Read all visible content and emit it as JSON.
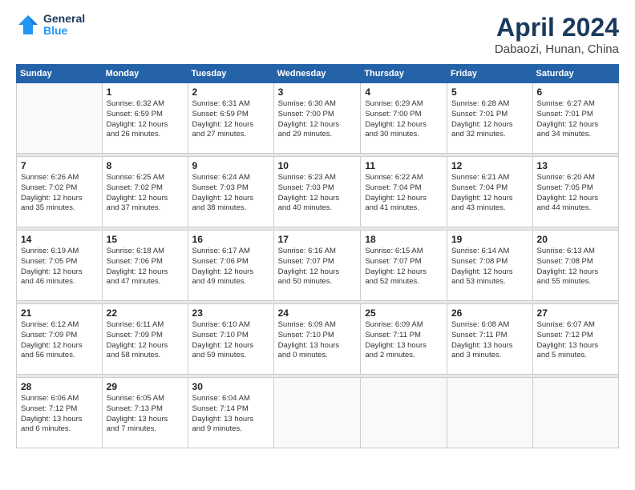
{
  "header": {
    "logo_line1": "General",
    "logo_line2": "Blue",
    "month_title": "April 2024",
    "location": "Dabaozi, Hunan, China"
  },
  "weekdays": [
    "Sunday",
    "Monday",
    "Tuesday",
    "Wednesday",
    "Thursday",
    "Friday",
    "Saturday"
  ],
  "weeks": [
    [
      {
        "day": "",
        "content": ""
      },
      {
        "day": "1",
        "content": "Sunrise: 6:32 AM\nSunset: 6:59 PM\nDaylight: 12 hours\nand 26 minutes."
      },
      {
        "day": "2",
        "content": "Sunrise: 6:31 AM\nSunset: 6:59 PM\nDaylight: 12 hours\nand 27 minutes."
      },
      {
        "day": "3",
        "content": "Sunrise: 6:30 AM\nSunset: 7:00 PM\nDaylight: 12 hours\nand 29 minutes."
      },
      {
        "day": "4",
        "content": "Sunrise: 6:29 AM\nSunset: 7:00 PM\nDaylight: 12 hours\nand 30 minutes."
      },
      {
        "day": "5",
        "content": "Sunrise: 6:28 AM\nSunset: 7:01 PM\nDaylight: 12 hours\nand 32 minutes."
      },
      {
        "day": "6",
        "content": "Sunrise: 6:27 AM\nSunset: 7:01 PM\nDaylight: 12 hours\nand 34 minutes."
      }
    ],
    [
      {
        "day": "7",
        "content": "Sunrise: 6:26 AM\nSunset: 7:02 PM\nDaylight: 12 hours\nand 35 minutes."
      },
      {
        "day": "8",
        "content": "Sunrise: 6:25 AM\nSunset: 7:02 PM\nDaylight: 12 hours\nand 37 minutes."
      },
      {
        "day": "9",
        "content": "Sunrise: 6:24 AM\nSunset: 7:03 PM\nDaylight: 12 hours\nand 38 minutes."
      },
      {
        "day": "10",
        "content": "Sunrise: 6:23 AM\nSunset: 7:03 PM\nDaylight: 12 hours\nand 40 minutes."
      },
      {
        "day": "11",
        "content": "Sunrise: 6:22 AM\nSunset: 7:04 PM\nDaylight: 12 hours\nand 41 minutes."
      },
      {
        "day": "12",
        "content": "Sunrise: 6:21 AM\nSunset: 7:04 PM\nDaylight: 12 hours\nand 43 minutes."
      },
      {
        "day": "13",
        "content": "Sunrise: 6:20 AM\nSunset: 7:05 PM\nDaylight: 12 hours\nand 44 minutes."
      }
    ],
    [
      {
        "day": "14",
        "content": "Sunrise: 6:19 AM\nSunset: 7:05 PM\nDaylight: 12 hours\nand 46 minutes."
      },
      {
        "day": "15",
        "content": "Sunrise: 6:18 AM\nSunset: 7:06 PM\nDaylight: 12 hours\nand 47 minutes."
      },
      {
        "day": "16",
        "content": "Sunrise: 6:17 AM\nSunset: 7:06 PM\nDaylight: 12 hours\nand 49 minutes."
      },
      {
        "day": "17",
        "content": "Sunrise: 6:16 AM\nSunset: 7:07 PM\nDaylight: 12 hours\nand 50 minutes."
      },
      {
        "day": "18",
        "content": "Sunrise: 6:15 AM\nSunset: 7:07 PM\nDaylight: 12 hours\nand 52 minutes."
      },
      {
        "day": "19",
        "content": "Sunrise: 6:14 AM\nSunset: 7:08 PM\nDaylight: 12 hours\nand 53 minutes."
      },
      {
        "day": "20",
        "content": "Sunrise: 6:13 AM\nSunset: 7:08 PM\nDaylight: 12 hours\nand 55 minutes."
      }
    ],
    [
      {
        "day": "21",
        "content": "Sunrise: 6:12 AM\nSunset: 7:09 PM\nDaylight: 12 hours\nand 56 minutes."
      },
      {
        "day": "22",
        "content": "Sunrise: 6:11 AM\nSunset: 7:09 PM\nDaylight: 12 hours\nand 58 minutes."
      },
      {
        "day": "23",
        "content": "Sunrise: 6:10 AM\nSunset: 7:10 PM\nDaylight: 12 hours\nand 59 minutes."
      },
      {
        "day": "24",
        "content": "Sunrise: 6:09 AM\nSunset: 7:10 PM\nDaylight: 13 hours\nand 0 minutes."
      },
      {
        "day": "25",
        "content": "Sunrise: 6:09 AM\nSunset: 7:11 PM\nDaylight: 13 hours\nand 2 minutes."
      },
      {
        "day": "26",
        "content": "Sunrise: 6:08 AM\nSunset: 7:11 PM\nDaylight: 13 hours\nand 3 minutes."
      },
      {
        "day": "27",
        "content": "Sunrise: 6:07 AM\nSunset: 7:12 PM\nDaylight: 13 hours\nand 5 minutes."
      }
    ],
    [
      {
        "day": "28",
        "content": "Sunrise: 6:06 AM\nSunset: 7:12 PM\nDaylight: 13 hours\nand 6 minutes."
      },
      {
        "day": "29",
        "content": "Sunrise: 6:05 AM\nSunset: 7:13 PM\nDaylight: 13 hours\nand 7 minutes."
      },
      {
        "day": "30",
        "content": "Sunrise: 6:04 AM\nSunset: 7:14 PM\nDaylight: 13 hours\nand 9 minutes."
      },
      {
        "day": "",
        "content": ""
      },
      {
        "day": "",
        "content": ""
      },
      {
        "day": "",
        "content": ""
      },
      {
        "day": "",
        "content": ""
      }
    ]
  ]
}
